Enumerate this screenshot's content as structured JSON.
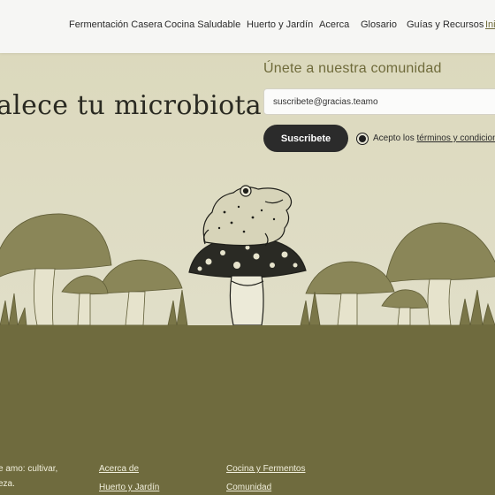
{
  "nav": {
    "items": [
      {
        "label": "Fermentación Casera"
      },
      {
        "label": "Cocina Saludable"
      },
      {
        "label": "Huerto y Jardín"
      },
      {
        "label": "Acerca"
      },
      {
        "label": "Glosario"
      },
      {
        "label": "Guías y Recursos"
      },
      {
        "label": "Ini"
      }
    ]
  },
  "hero": {
    "title": "alece tu microbiota"
  },
  "newsletter": {
    "title": "Únete a nuestra comunidad",
    "email_value": "suscribete@gracias.teamo",
    "subscribe_label": "Suscribete",
    "consent_prefix": "Acepto los ",
    "consent_link": "términos y condicion"
  },
  "footer": {
    "about_lines": [
      "e amo: cultivar,",
      "eza."
    ],
    "col1": [
      "Acerca de",
      "Huerto y Jardín"
    ],
    "col2": [
      "Cocina y Fermentos",
      "Comunidad"
    ]
  },
  "colors": {
    "footer_bg": "#6f6b3e",
    "hero_bg": "#dedbc3",
    "illustration": "#7a7648",
    "accent_text": "#6f6b3b"
  },
  "icons": {
    "consent": "radio-selected-icon",
    "art": "mushroom-frog-illustration"
  }
}
